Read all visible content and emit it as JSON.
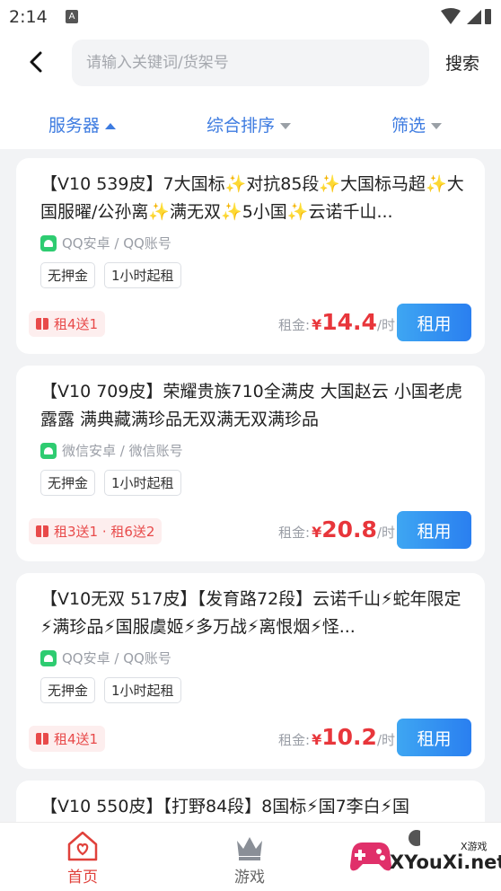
{
  "status_bar": {
    "time": "2:14"
  },
  "header": {
    "search_placeholder": "请输入关键词/货架号",
    "search_button": "搜索"
  },
  "filters": {
    "server": "服务器",
    "sort": "综合排序",
    "filter": "筛选"
  },
  "listings": [
    {
      "title": "【V10 539皮】7大国标✨对抗85段✨大国标马超✨大国服曜/公孙离✨满无双✨5小国✨云诺千山...",
      "platform": "QQ安卓 / QQ账号",
      "tags": [
        "无押金",
        "1小时起租"
      ],
      "promo": "租4送1",
      "price_label": "租金:",
      "currency": "¥",
      "price": "14.4",
      "unit": "/时",
      "rent_label": "租用"
    },
    {
      "title": "【V10 709皮】荣耀贵族710全满皮 大国赵云 小国老虎露露 满典藏满珍品无双满无双满珍品",
      "platform": "微信安卓 / 微信账号",
      "tags": [
        "无押金",
        "1小时起租"
      ],
      "promo": "租3送1 · 租6送2",
      "price_label": "租金:",
      "currency": "¥",
      "price": "20.8",
      "unit": "/时",
      "rent_label": "租用"
    },
    {
      "title": "【V10无双 517皮】【发育路72段】云诺千山⚡蛇年限定⚡满珍品⚡国服虞姬⚡多万战⚡离恨烟⚡怪...",
      "platform": "QQ安卓 / QQ账号",
      "tags": [
        "无押金",
        "1小时起租"
      ],
      "promo": "租4送1",
      "price_label": "租金:",
      "currency": "¥",
      "price": "10.2",
      "unit": "/时",
      "rent_label": "租用"
    },
    {
      "title": "【V10 550皮】【打野84段】8国标⚡国7李白⚡国"
    }
  ],
  "tabbar": {
    "home": "首页",
    "games": "游戏"
  },
  "watermark": {
    "text": "XYouXi.net",
    "small": "X游戏"
  },
  "colors": {
    "accent_blue": "#3d7be0",
    "price_red": "#e8363b",
    "button_blue": "#2a7ff0"
  }
}
